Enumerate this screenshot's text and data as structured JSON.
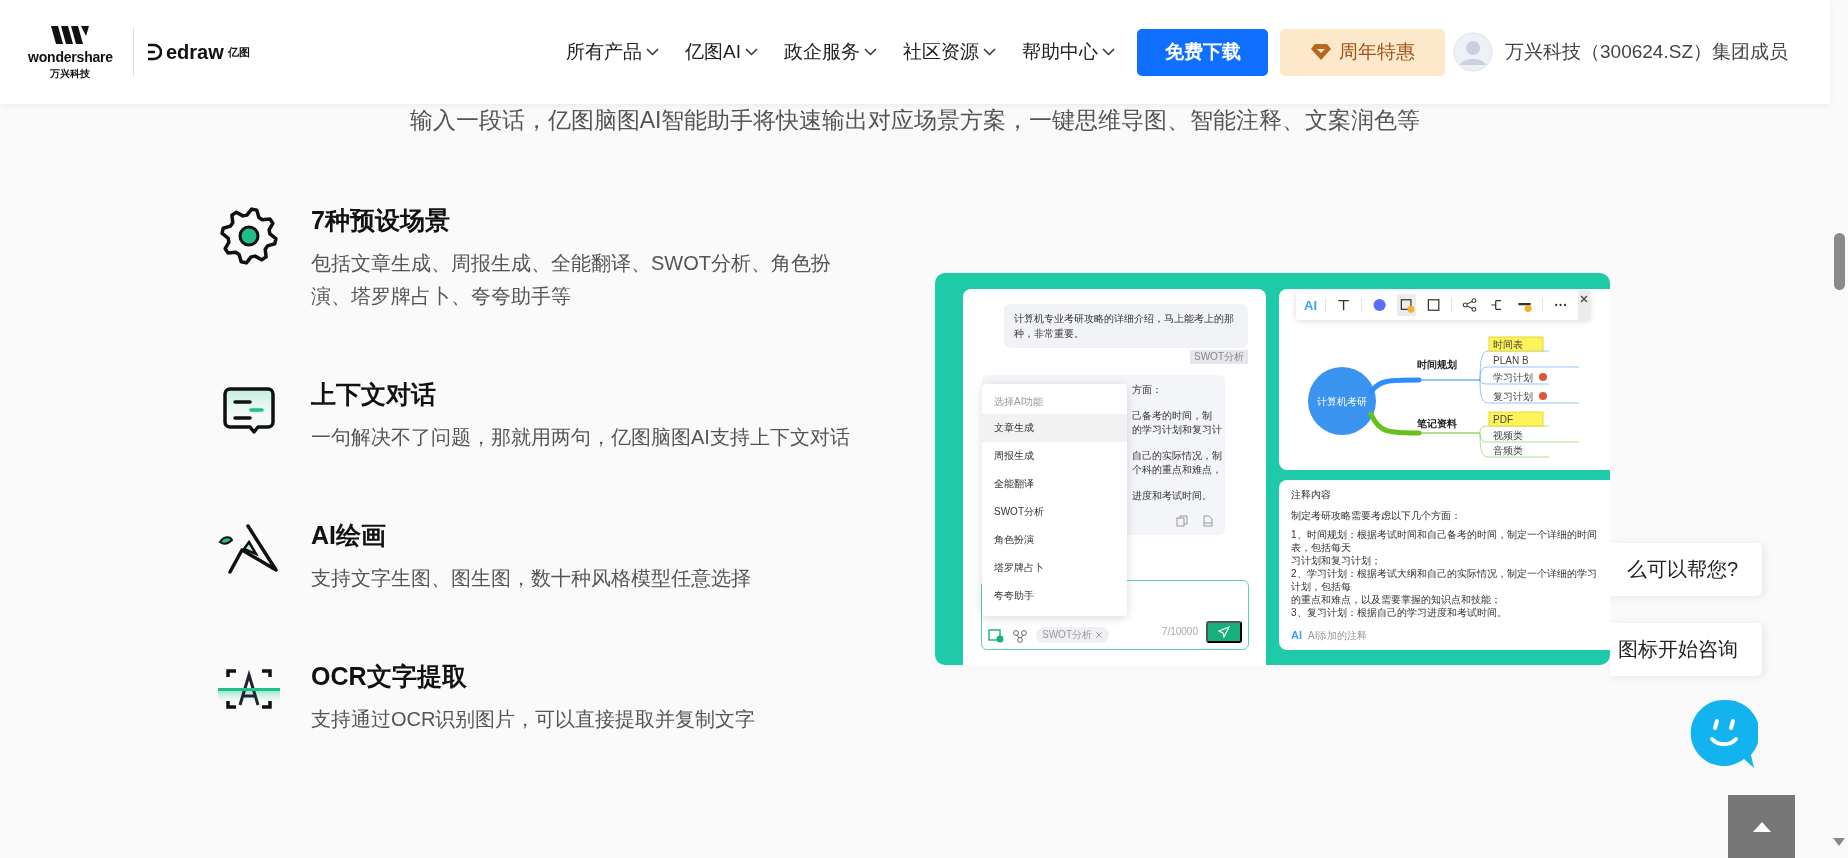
{
  "header": {
    "logo": {
      "brand": "wondershare",
      "brand_cn": "万兴科技",
      "product": "edraw",
      "product_cn": "亿图"
    },
    "nav": [
      {
        "label": "所有产品"
      },
      {
        "label": "亿图AI"
      },
      {
        "label": "政企服务"
      },
      {
        "label": "社区资源"
      },
      {
        "label": "帮助中心"
      }
    ],
    "download_button": "免费下载",
    "promo_button": "周年特惠",
    "group_text": "万兴科技（300624.SZ）集团成员"
  },
  "intro": "输入一段话，亿图脑图AI智能助手将快速输出对应场景方案，一键思维导图、智能注释、文案润色等",
  "features": [
    {
      "kind": "scenes",
      "title": "7种预设场景",
      "description": "包括文章生成、周报生成、全能翻译、SWOT分析、角色扮演、塔罗牌占卜、夸夸助手等"
    },
    {
      "kind": "dialog",
      "title": "上下文对话",
      "description": "一句解决不了问题，那就用两句，亿图脑图AI支持上下文对话"
    },
    {
      "kind": "painting",
      "title": "AI绘画",
      "description": "支持文字生图、图生图，数十种风格模型任意选择"
    },
    {
      "kind": "ocr",
      "title": "OCR文字提取",
      "description": "支持通过OCR识别图片，可以直接提取并复制文字"
    }
  ],
  "demo": {
    "chat": {
      "user_message": "计算机专业考研攻略的详细介绍，马上能考上的那种，非常重要。",
      "message_tag": "SWOT分析",
      "reply_paragraphs": [
        [
          "方面："
        ],
        [
          "己备考的时间，制",
          "的学习计划和复习计"
        ],
        [
          "自己的实际情况，制",
          "个科的重点和难点，"
        ],
        [
          "进度和考试时间。"
        ]
      ],
      "menu": {
        "header": "选择AI功能",
        "items": [
          {
            "label": "文章生成",
            "selected": true
          },
          {
            "label": "周报生成",
            "selected": false
          },
          {
            "label": "全能翻译",
            "selected": false
          },
          {
            "label": "SWOT分析",
            "selected": false
          },
          {
            "label": "角色扮演",
            "selected": false
          },
          {
            "label": "塔罗牌占卜",
            "selected": false
          },
          {
            "label": "夸夸助手",
            "selected": false
          }
        ]
      },
      "input": {
        "chip": "SWOT分析",
        "counter": "7/10000"
      }
    },
    "mindmap": {
      "toolbar": {
        "ai_label": "AI",
        "tools": [
          {
            "kind": "text",
            "selected": false
          },
          {
            "kind": "fill",
            "selected": false
          },
          {
            "kind": "crop",
            "selected": true
          },
          {
            "kind": "shape",
            "selected": false
          },
          {
            "kind": "share",
            "selected": false
          },
          {
            "kind": "branch",
            "selected": false
          },
          {
            "kind": "line",
            "selected": false
          },
          {
            "kind": "more",
            "selected": false
          }
        ]
      },
      "root": "计算机考研",
      "branches": [
        {
          "label": "时间规划",
          "color": "#2f8cff",
          "children": [
            {
              "label": "时间表",
              "highlighted": true,
              "flagged": false
            },
            {
              "label": "PLAN B",
              "highlighted": false,
              "flagged": false
            },
            {
              "label": "学习计划",
              "highlighted": false,
              "flagged": true
            },
            {
              "label": "复习计划",
              "highlighted": false,
              "flagged": true
            }
          ]
        },
        {
          "label": "笔记资料",
          "color": "#66c21a",
          "children": [
            {
              "label": "PDF",
              "highlighted": true,
              "flagged": false
            },
            {
              "label": "视频类",
              "highlighted": false,
              "flagged": false
            },
            {
              "label": "音频类",
              "highlighted": false,
              "flagged": false
            }
          ]
        }
      ]
    },
    "notes": {
      "title": "注释内容",
      "intro": "制定考研攻略需要考虑以下几个方面：",
      "lines": [
        "1、时间规划：根据考试时间和自己备考的时间，制定一个详细的时间表，包括每天",
        "习计划和复习计划；",
        "2、学习计划：根据考试大纲和自己的实际情况，制定一个详细的学习计划，包括每",
        "的重点和难点，以及需要掌握的知识点和技能；",
        "3、复习计划：根据自己的学习进度和考试时间。"
      ],
      "footer_badge": "AI",
      "footer": "AI添加的注释"
    }
  },
  "chat_widget": {
    "bubbles": [
      "么可以帮您?",
      "图标开始咨询"
    ]
  }
}
